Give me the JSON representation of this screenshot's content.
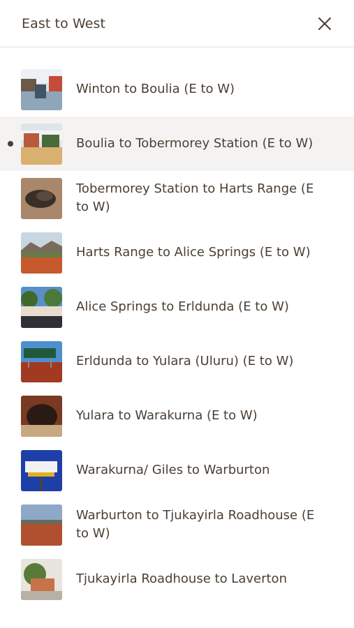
{
  "header": {
    "title": "East to West",
    "close_icon": "close-icon"
  },
  "colors": {
    "text": "#4a3f35",
    "active_row_bg": "#f5f3f1",
    "divider": "#e6e3df"
  },
  "active_index": 1,
  "items": [
    {
      "label": "Winton to Boulia (E to W)"
    },
    {
      "label": "Boulia to Tobermorey Station (E to W)"
    },
    {
      "label": "Tobermorey Station to Harts Range (E to W)"
    },
    {
      "label": "Harts Range to Alice Springs (E to W)"
    },
    {
      "label": "Alice Springs to Erldunda (E to W)"
    },
    {
      "label": "Erldunda to Yulara (Uluru) (E to W)"
    },
    {
      "label": "Yulara to Warakurna (E to W)"
    },
    {
      "label": "Warakurna/ Giles to Warburton"
    },
    {
      "label": "Warburton to Tjukayirla Roadhouse (E to W)"
    },
    {
      "label": "Tjukayirla Roadhouse to Laverton"
    }
  ]
}
